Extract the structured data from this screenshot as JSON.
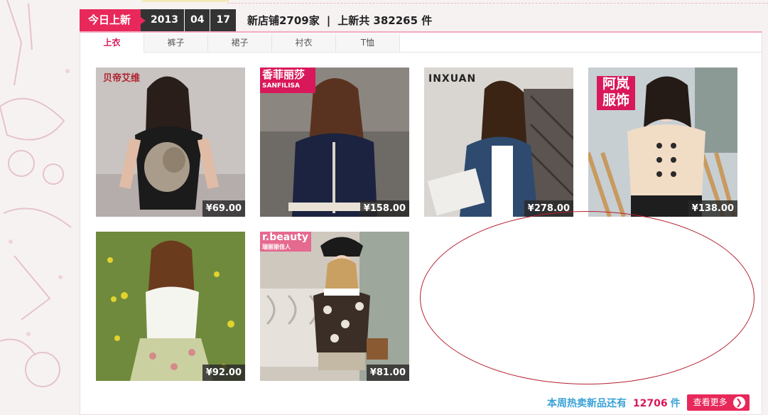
{
  "header": {
    "badge": "今日上新",
    "year": "2013",
    "month": "04",
    "day": "17",
    "stores": "新店铺2709家",
    "separator": "|",
    "new_total": "上新共 382265 件"
  },
  "tabs": [
    {
      "label": "上衣",
      "active": true
    },
    {
      "label": "裤子",
      "active": false
    },
    {
      "label": "裙子",
      "active": false
    },
    {
      "label": "衬衣",
      "active": false
    },
    {
      "label": "T恤",
      "active": false
    }
  ],
  "products": [
    {
      "brand": "贝帝艾维",
      "price": "¥69.00",
      "image": "woman-black-floral-top"
    },
    {
      "brand": "香菲丽莎",
      "brand_sub": "SANFILISA",
      "price": "¥158.00",
      "image": "woman-navy-shirt"
    },
    {
      "brand": "INXUAN",
      "price": "¥278.00",
      "image": "woman-denim-jacket"
    },
    {
      "brand": "阿岚服饰",
      "price": "¥138.00",
      "image": "woman-cream-blouse"
    },
    {
      "brand": "",
      "price": "¥92.00",
      "image": "woman-white-top-floral-skirt"
    },
    {
      "brand": "r.beauty",
      "brand_sub": "瑞丽丽佳人",
      "price": "¥81.00",
      "image": "woman-print-shirt-hat"
    }
  ],
  "footer": {
    "text_before": "本周热卖新品还有",
    "count": "12706",
    "text_after": "件",
    "more_label": "查看更多",
    "more_icon": "chevron-right-icon"
  },
  "colors": {
    "accent": "#e8285a",
    "date_bg": "#333333",
    "link_blue": "#3aa2d6",
    "ellipse": "#b52030"
  }
}
